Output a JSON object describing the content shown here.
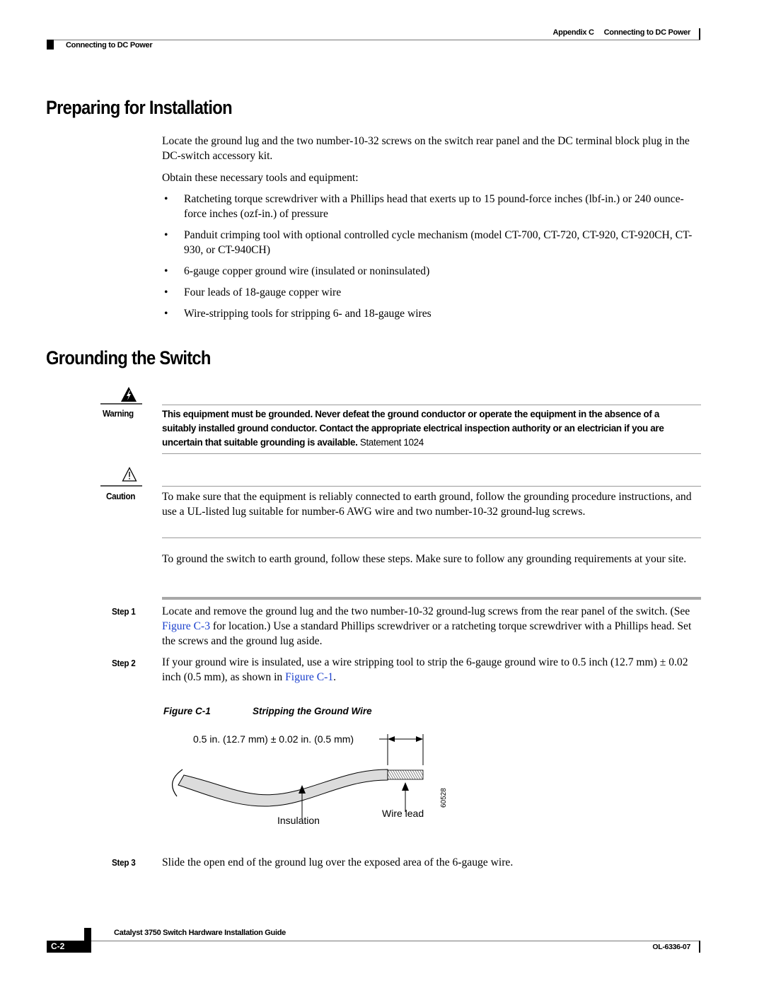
{
  "header": {
    "appendix": "Appendix C",
    "chapter_title_right": "Connecting to DC Power",
    "chapter_title_left": "Connecting to DC Power"
  },
  "sections": {
    "preparing": {
      "title": "Preparing for Installation",
      "intro": "Locate the ground lug and the two number-10-32 screws on the switch rear panel and the DC terminal block plug in the DC-switch accessory kit.",
      "lead": "Obtain these necessary tools and equipment:",
      "bullets": [
        "Ratcheting torque screwdriver with a Phillips head that exerts up to 15 pound-force inches (lbf-in.) or 240 ounce-force inches (ozf-in.) of pressure",
        "Panduit crimping tool with optional controlled cycle mechanism (model CT-700, CT-720, CT-920, CT-920CH, CT-930, or CT-940CH)",
        "6-gauge copper ground wire (insulated or noninsulated)",
        "Four leads of 18-gauge copper wire",
        "Wire-stripping tools for stripping 6- and 18-gauge wires"
      ],
      "bullet_glyph": "•"
    },
    "grounding": {
      "title": "Grounding the Switch",
      "warning": {
        "label": "Warning",
        "icon": "electrical-hazard-icon",
        "text": "This equipment must be grounded. Never defeat the ground conductor or operate the equipment in the absence of a suitably installed ground conductor. Contact the appropriate electrical inspection authority or an electrician if you are uncertain that suitable grounding is available.",
        "statement": " Statement 1024"
      },
      "caution": {
        "label": "Caution",
        "icon": "caution-triangle-icon",
        "text": "To make sure that the equipment is reliably connected to earth ground, follow the grounding procedure instructions, and use a UL-listed lug suitable for number-6 AWG wire and two number-10-32 ground-lug screws."
      },
      "intro": "To ground the switch to earth ground, follow these steps. Make sure to follow any grounding requirements at your site.",
      "steps": [
        {
          "label": "Step 1",
          "text_before": "Locate and remove the ground lug and the two number-10-32 ground-lug screws from the rear panel of the switch. (See ",
          "link": "Figure C-3",
          "text_after": " for location.) Use a standard Phillips screwdriver or a ratcheting torque screwdriver with a Phillips head. Set the screws and the ground lug aside."
        },
        {
          "label": "Step 2",
          "text_before": "If your ground wire is insulated, use a wire stripping tool to strip the 6-gauge ground wire to 0.5 inch (12.7 mm) ± 0.02 inch (0.5 mm), as shown in ",
          "link": "Figure C-1",
          "text_after": "."
        },
        {
          "label": "Step 3",
          "text_before": "Slide the open end of the ground lug over the exposed area of the 6-gauge wire.",
          "link": "",
          "text_after": ""
        }
      ]
    }
  },
  "figure": {
    "number": "Figure C-1",
    "title": "Stripping the Ground Wire",
    "dimension_label": "0.5 in. (12.7 mm) ± 0.02 in. (0.5 mm)",
    "insulation_label": "Insulation",
    "wire_lead_label": "Wire lead",
    "figure_id": "60528"
  },
  "footer": {
    "guide_title": "Catalyst 3750 Switch Hardware Installation Guide",
    "page_number": "C-2",
    "doc_number": "OL-6336-07"
  }
}
